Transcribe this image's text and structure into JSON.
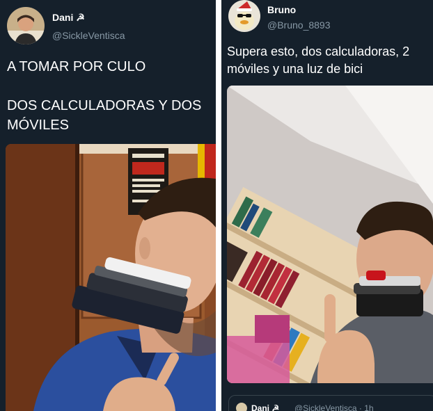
{
  "left_tweet": {
    "name": "Dani ☭",
    "handle": "@SickleVentisca",
    "text": "A TOMAR POR CULO\n\nDOS CALCULADORAS Y DOS\nMÓVILES",
    "avatar_icon": "user-avatar-photo",
    "photo_icon": "photo-man-with-calculators-and-phones-in-mouth"
  },
  "right_tweet": {
    "name": "Bruno",
    "handle": "@Bruno_8893",
    "text": "Supera esto, dos calculadoras, 2\nmóviles y una luz de bici",
    "avatar_icon": "duck-with-sunglasses-and-santa-hat",
    "photo_icon": "photo-man-with-calculators-phones-and-bike-light-in-mouth"
  },
  "quoted_tweet": {
    "name": "Dani ☭",
    "handle": "@SickleVentisca · 1h"
  },
  "colors": {
    "background": "#15202b",
    "text": "#ffffff",
    "secondary_text": "#8899a6",
    "divider": "#ffffff"
  }
}
